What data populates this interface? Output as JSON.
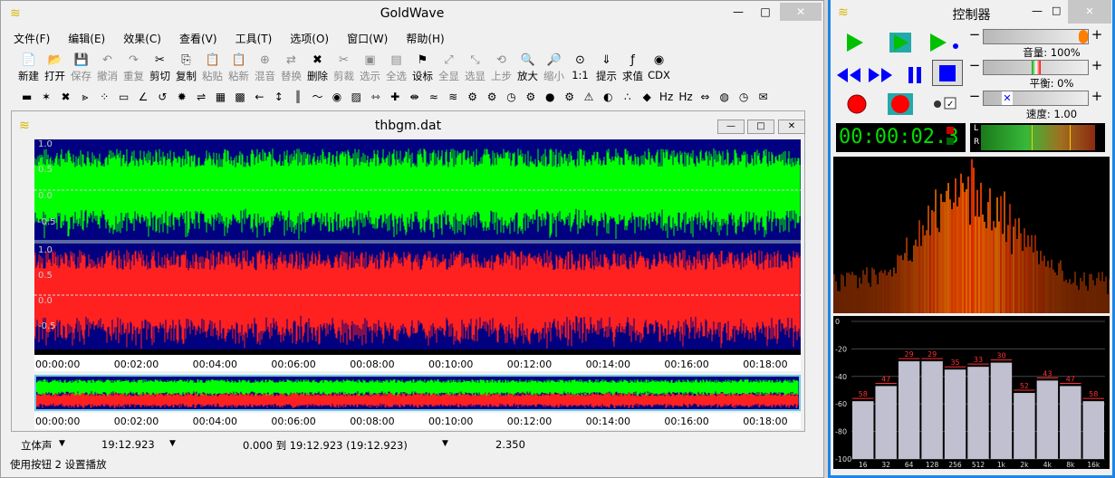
{
  "app": {
    "title": "GoldWave",
    "window_buttons": {
      "minimize": "—",
      "maximize": "□",
      "close": "✕"
    }
  },
  "menu": [
    "文件(F)",
    "编辑(E)",
    "效果(C)",
    "查看(V)",
    "工具(T)",
    "选项(O)",
    "窗口(W)",
    "帮助(H)"
  ],
  "toolbar": [
    {
      "label": "新建",
      "icon": "new-icon",
      "enabled": true
    },
    {
      "label": "打开",
      "icon": "open-icon",
      "enabled": true
    },
    {
      "label": "保存",
      "icon": "save-icon",
      "enabled": false
    },
    {
      "label": "撤消",
      "icon": "undo-icon",
      "enabled": false
    },
    {
      "label": "重复",
      "icon": "redo-icon",
      "enabled": false
    },
    {
      "label": "剪切",
      "icon": "cut-icon",
      "enabled": true
    },
    {
      "label": "复制",
      "icon": "copy-icon",
      "enabled": true
    },
    {
      "label": "粘贴",
      "icon": "paste-icon",
      "enabled": false
    },
    {
      "label": "粘新",
      "icon": "paste-new-icon",
      "enabled": false
    },
    {
      "label": "混音",
      "icon": "mix-icon",
      "enabled": false
    },
    {
      "label": "替换",
      "icon": "replace-icon",
      "enabled": false
    },
    {
      "label": "删除",
      "icon": "delete-icon",
      "enabled": true
    },
    {
      "label": "剪裁",
      "icon": "trim-icon",
      "enabled": false
    },
    {
      "label": "选示",
      "icon": "select-view-icon",
      "enabled": false
    },
    {
      "label": "全选",
      "icon": "select-all-icon",
      "enabled": false
    },
    {
      "label": "设标",
      "icon": "set-marker-icon",
      "enabled": true
    },
    {
      "label": "全显",
      "icon": "show-all-icon",
      "enabled": false
    },
    {
      "label": "选显",
      "icon": "show-selection-icon",
      "enabled": false
    },
    {
      "label": "上步",
      "icon": "previous-icon",
      "enabled": false
    },
    {
      "label": "放大",
      "icon": "zoom-in-icon",
      "enabled": true
    },
    {
      "label": "缩小",
      "icon": "zoom-out-icon",
      "enabled": false
    },
    {
      "label": "1:1",
      "icon": "zoom-1-1-icon",
      "enabled": true
    },
    {
      "label": "提示",
      "icon": "cue-icon",
      "enabled": true
    },
    {
      "label": "求值",
      "icon": "evaluate-icon",
      "enabled": true
    },
    {
      "label": "CDX",
      "icon": "cd-extract-icon",
      "enabled": true
    }
  ],
  "toolbar2_icons": [
    "minus-icon",
    "fx-icon",
    "fx2-icon",
    "arrow-icon",
    "dots-icon",
    "bar-icon",
    "angle-icon",
    "loop-icon",
    "gear-icon",
    "swap-icon",
    "grid-icon",
    "grid2-icon",
    "left-arrow-icon",
    "updown-icon",
    "bars-icon",
    "wave-icon",
    "eye-icon",
    "color-icon",
    "stretch-icon",
    "cross-icon",
    "squeeze-icon",
    "wave2-icon",
    "wave3-icon",
    "gear2-icon",
    "gear3-icon",
    "clock-icon",
    "gear4-icon",
    "disc-icon",
    "gear5-icon",
    "warn-icon",
    "circle-icon",
    "dots2-icon",
    "diamond-icon",
    "hz-icon",
    "hz2-icon",
    "arrows-icon",
    "globe-icon",
    "clock2-icon",
    "mail-icon"
  ],
  "sound_window": {
    "title": "thbgm.dat",
    "buttons": [
      "—",
      "□",
      "✕"
    ],
    "left_labels_top": [
      "1.0",
      "0.5",
      "0.0",
      "-0.5"
    ],
    "left_labels_bottom": [
      "1.0",
      "0.5",
      "0.0",
      "-0.5"
    ],
    "timeline": [
      "00:00:00",
      "00:02:00",
      "00:04:00",
      "00:06:00",
      "00:08:00",
      "00:10:00",
      "00:12:00",
      "00:14:00",
      "00:16:00",
      "00:18:00"
    ],
    "colors": {
      "left_channel": "#00ff00",
      "right_channel": "#ff2020",
      "background": "#000080"
    }
  },
  "status": {
    "channel": "立体声",
    "duration": "19:12.923",
    "selection": "0.000 到 19:12.923 (19:12.923)",
    "position": "2.350",
    "hint": "使用按钮 2 设置播放"
  },
  "controller": {
    "title": "控制器",
    "volume_label": "音量: 100%",
    "balance_label": "平衡: 0%",
    "speed_label": "速度: 1.00",
    "time": "00:00:02.3",
    "lr": [
      "L",
      "R"
    ],
    "eq_ylabels": [
      "0",
      "-20",
      "-40",
      "-60",
      "-80",
      "-100"
    ],
    "eq_xlabels": [
      "16",
      "32",
      "64",
      "128",
      "256",
      "512",
      "1k",
      "2k",
      "4k",
      "8k",
      "16k"
    ],
    "eq_values": [
      58,
      47,
      29,
      29,
      35,
      33,
      30,
      52,
      43,
      47,
      58
    ],
    "colors": {
      "play": "#00c000",
      "transport": "#0000ff",
      "record": "#ff0000"
    }
  }
}
